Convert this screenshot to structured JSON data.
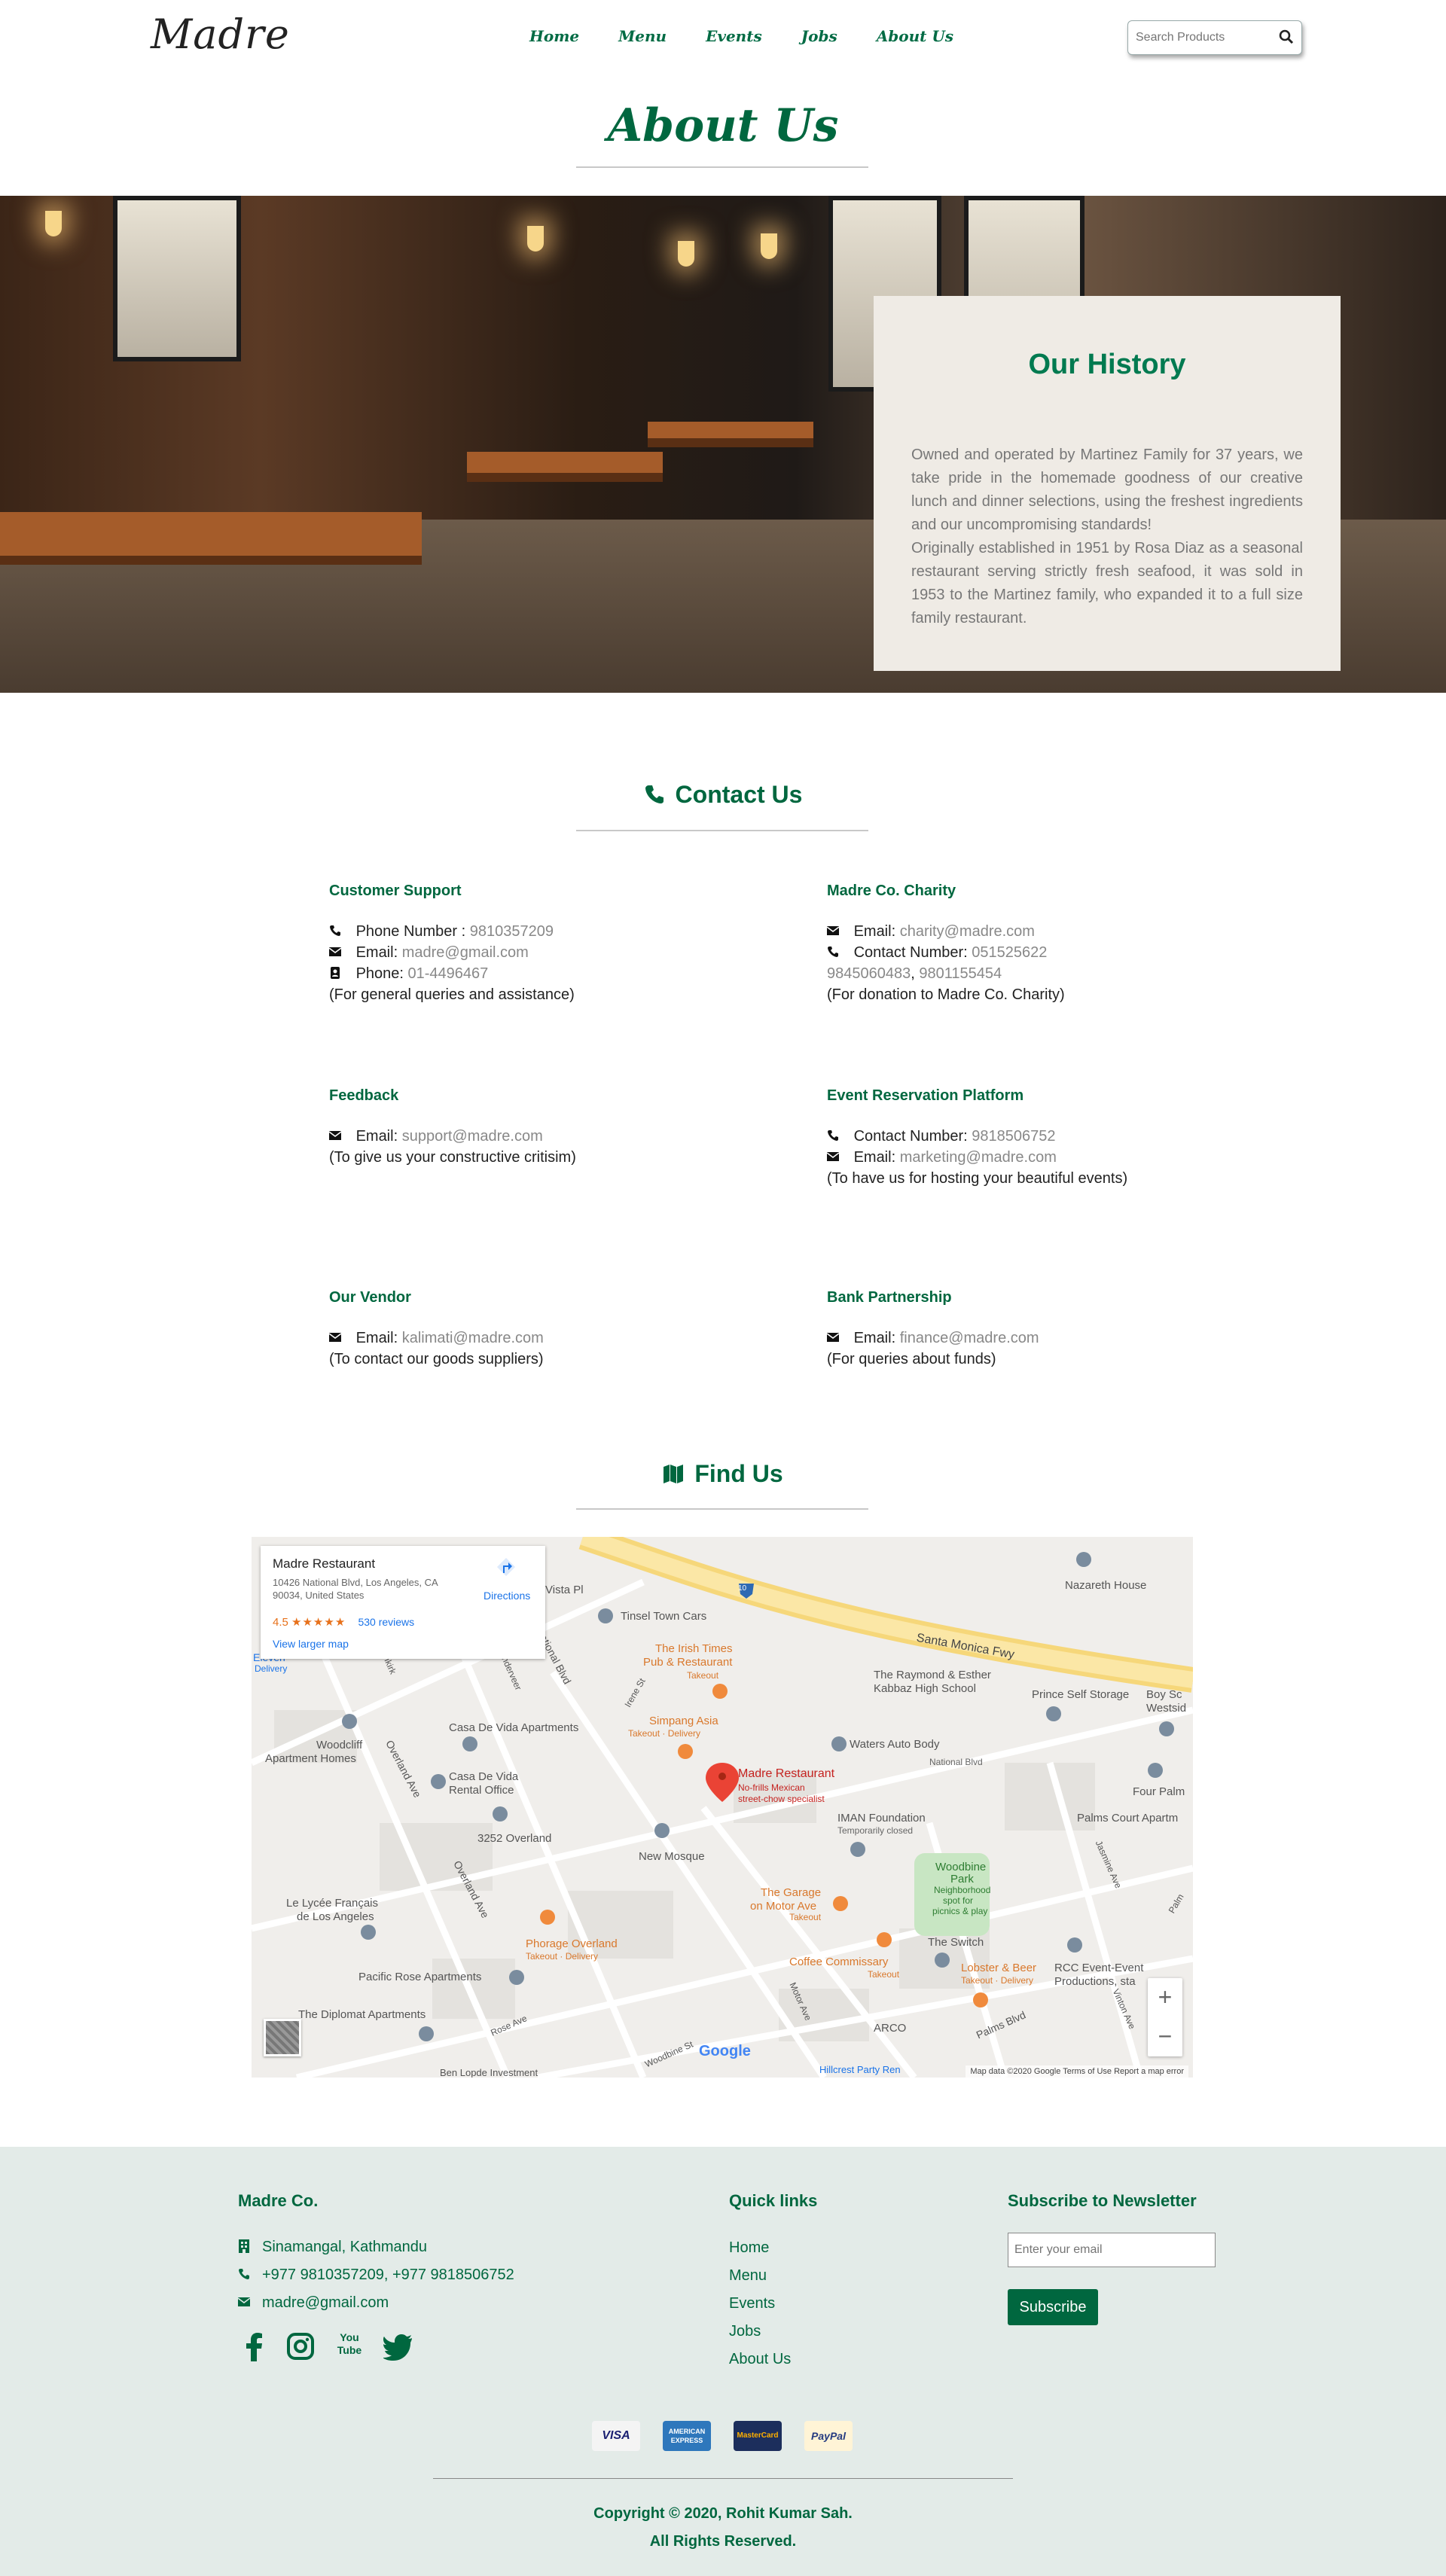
{
  "nav": {
    "logo": "Madre",
    "links": [
      "Home",
      "Menu",
      "Events",
      "Jobs",
      "About Us"
    ],
    "search_placeholder": "Search Products"
  },
  "page": {
    "title": "About Us"
  },
  "history": {
    "title": "Our History",
    "paragraph1": "Owned and operated by Martinez Family for 37 years, we take pride in the homemade goodness of our creative lunch and dinner selections, using the freshest ingredients and our uncompromising standards!",
    "paragraph2": "Originally established in 1951 by Rosa Diaz as a seasonal restaurant serving strictly fresh seafood, it was sold in 1953 to the Martinez family, who expanded it to a full size family restaurant."
  },
  "contact": {
    "heading": "Contact Us",
    "customer_support": {
      "title": "Customer Support",
      "phone_label": "Phone Number :",
      "phone": "9810357209",
      "email_label": "Email:",
      "email": "madre@gmail.com",
      "phone2_label": "Phone:",
      "phone2": "01-4496467",
      "note": "(For general queries and assistance)"
    },
    "charity": {
      "title": "Madre Co. Charity",
      "email_label": "Email:",
      "email": "charity@madre.com",
      "contact_label": "Contact Number:",
      "contact": "051525622",
      "mobile1": "9845060483",
      "separator": ",",
      "mobile2": "9801155454",
      "note": "(For donation to Madre Co. Charity)"
    },
    "feedback": {
      "title": "Feedback",
      "email_label": "Email:",
      "email": "support@madre.com",
      "note": "(To give us your constructive critisim)"
    },
    "event": {
      "title": "Event Reservation Platform",
      "contact_label": "Contact Number:",
      "contact": "9818506752",
      "email_label": "Email:",
      "email": "marketing@madre.com",
      "note": "(To have us for hosting your beautiful events)"
    },
    "vendor": {
      "title": "Our Vendor",
      "email_label": "Email:",
      "email": "kalimati@madre.com",
      "note": "(To contact our goods suppliers)"
    },
    "bank": {
      "title": "Bank Partnership",
      "email_label": "Email:",
      "email": "finance@madre.com",
      "note": "(For queries about funds)"
    }
  },
  "find": {
    "heading": "Find Us",
    "card": {
      "name": "Madre Restaurant",
      "address": "10426 National Blvd, Los Angeles, CA 90034, United States",
      "rating": "4.5",
      "stars": "★★★★★",
      "reviews": "530 reviews",
      "larger_map": "View larger map",
      "directions": "Directions"
    },
    "labels": {
      "vista": "Vista Pl",
      "tinsel": "Tinsel Town Cars",
      "nazareth": "Nazareth House",
      "freeway": "Santa Monica Fwy",
      "irish": "The Irish Times",
      "irish2": "Pub & Restaurant",
      "takeout": "Takeout",
      "raymond": "The Raymond & Esther",
      "raymond2": "Kabbaz High School",
      "prince": "Prince Self Storage",
      "boy": "Boy Sc",
      "westside": "Westsid",
      "eleven": "Eleven",
      "delivery": "Delivery",
      "casa": "Casa De Vida Apartments",
      "simpang": "Simpang Asia",
      "takeout_delivery": "Takeout · Delivery",
      "waters": "Waters Auto Body",
      "national": "National Blvd",
      "woodcliff": "Woodcliff",
      "woodcliff2": "Apartment Homes",
      "casa_rental": "Casa De Vida",
      "casa_rental2": "Rental Office",
      "madre": "Madre Restaurant",
      "madre_sub1": "No-frills Mexican",
      "madre_sub2": "street-chow specialist",
      "four": "Four Palm",
      "palms_court": "Palms Court Apartm",
      "iman": "IMAN Foundation",
      "iman2": "Temporarily closed",
      "overland3252": "3252 Overland",
      "new_mosque": "New Mosque",
      "woodbine": "Woodbine",
      "woodbine2": "Park",
      "woodbine3": "Neighborhood",
      "woodbine4": "spot for",
      "woodbine5": "picnics & play",
      "lycee": "Le Lycée Français",
      "lycee2": "de Los Angeles",
      "garage": "The Garage",
      "garage2": "on Motor Ave",
      "phorage": "Phorage Overland",
      "coffee": "Coffee Commissary",
      "switch": "The Switch",
      "lobster": "Lobster & Beer",
      "rcc": "RCC Event-Event",
      "rcc2": "Productions, sta",
      "pacific": "Pacific Rose Apartments",
      "diplomat": "The Diplomat Apartments",
      "arco": "ARCO",
      "palms_blvd": "Palms Blvd",
      "overland_ave": "Overland Ave",
      "overland_ave2": "Overland Ave",
      "national_blvd": "National Blvd",
      "motor": "Motor Ave",
      "rose": "Rose Ave",
      "irene": "Irene St",
      "woodbine_st": "Woodbine St",
      "dunkirk": "Dunkirk",
      "vanderveer": "Vanderveer",
      "jasmine": "Jasmine Ave",
      "vinton": "Vinton Ave",
      "palm": "Palm",
      "hillcrest": "Hillcrest Party Ren",
      "ben": "Ben Lopde Investment",
      "freeway_shield": "10"
    },
    "zoom_in": "+",
    "zoom_out": "−",
    "google": "Google",
    "attribution": "Map data ©2020 Google   Terms of Use   Report a map error"
  },
  "footer": {
    "company": "Madre Co.",
    "address": "Sinamangal, Kathmandu",
    "phones": "+977 9810357209, +977 9818506752",
    "email": "madre@gmail.com",
    "quick_links_title": "Quick links",
    "quick_links": [
      "Home",
      "Menu",
      "Events",
      "Jobs",
      "About Us"
    ],
    "newsletter_title": "Subscribe to Newsletter",
    "email_placeholder": "Enter your email",
    "subscribe": "Subscribe",
    "payments": [
      "VISA",
      "AMERICAN EXPRESS",
      "MasterCard",
      "PayPal"
    ],
    "youtube": "You Tube",
    "copyright": "Copyright © 2020, Rohit Kumar Sah.",
    "rights": "All Rights Reserved."
  },
  "colors": {
    "brand_green": "#00673f",
    "footer_bg": "#e3ebe8",
    "history_card_bg": "#efebe5"
  }
}
